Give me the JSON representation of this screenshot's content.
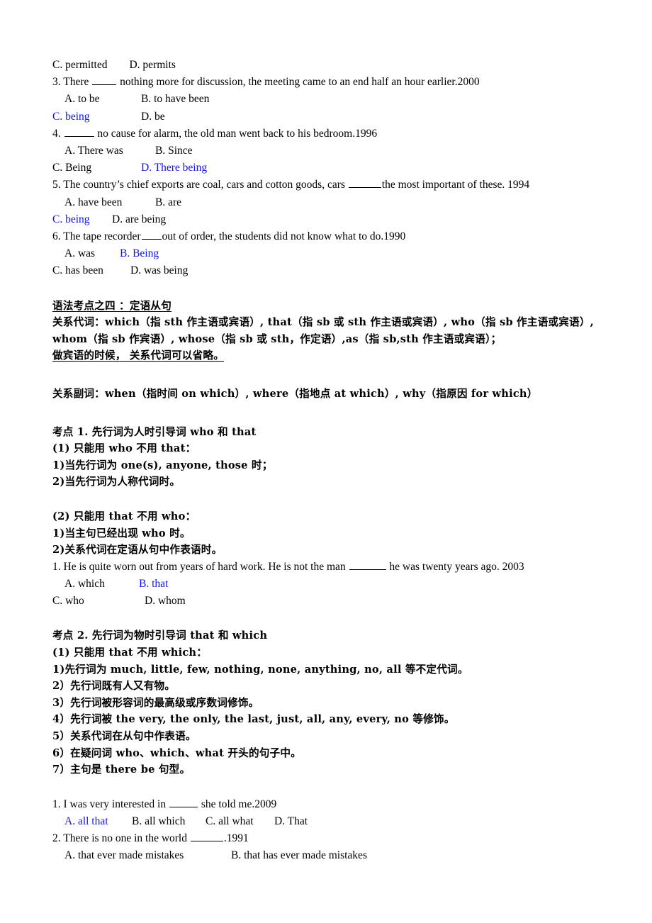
{
  "document": {
    "type": "grammar-study-notes",
    "language": "zh-CN + en",
    "answer_color": "#1414e6",
    "page_background": "#ffffff"
  },
  "block_prev_question": {
    "options_line": "C. permitted        D. permits"
  },
  "questions_being": [
    {
      "stem_pre": "3. There ",
      "stem_post": " nothing more for discussion, the meeting came to an end half an hour earlier.2000",
      "year": "2000",
      "row1": {
        "a": "A. to be",
        "b": "B. to have been",
        "a_correct": false,
        "b_correct": false
      },
      "row2": {
        "c": "C. being",
        "d": "D. be",
        "c_correct": true,
        "d_correct": false
      }
    },
    {
      "stem_pre": "4. ",
      "stem_post": " no cause for alarm, the old man went back to his bedroom.1996",
      "year": "1996",
      "row1": {
        "a": "A. There was",
        "b": "B. Since",
        "a_correct": false,
        "b_correct": false
      },
      "row2": {
        "c": "C. Being",
        "d": "D. There being",
        "c_correct": false,
        "d_correct": true
      }
    },
    {
      "stem_pre": "5. The country’s chief exports are coal, cars and cotton goods, cars ",
      "stem_post": "the most important of these. 1994",
      "year": "1994",
      "row1": {
        "a": "A. have been",
        "b": "B. are",
        "a_correct": false,
        "b_correct": false
      },
      "row2": {
        "c": "C. being",
        "d": "D. are being",
        "c_correct": true,
        "d_correct": false
      }
    },
    {
      "stem_pre": "6. The tape recorder",
      "stem_post": "out of order, the students did not know what to do.1990",
      "year": "1990",
      "row1": {
        "a": "A. was",
        "b": "B. Being",
        "a_correct": false,
        "b_correct": true
      },
      "row2": {
        "c": "C. has been",
        "d": "D. was being",
        "c_correct": false,
        "d_correct": false
      }
    }
  ],
  "section_four": {
    "title": "语法考点之四 ：定语从句",
    "relative_pronouns_line1": "关系代词：which（指 sth 作主语或宾语）, that（指 sb 或 sth 作主语或宾语）, who（指 sb 作主语或宾语）,",
    "relative_pronouns_line2": "whom（指 sb 作宾语）, whose（指 sb 或 sth，作定语）,as（指 sb,sth 作主语或宾语）；",
    "omission_note": "做宾语的时候， 关系代词可以省略。",
    "relative_adverbs": "关系副词：when（指时间 on which）, where（指地点 at which）, why（指原因 for which）"
  },
  "point_1": {
    "heading": "考点 1. 先行词为人时引导词 who 和 that",
    "sub_a": {
      "label": "(1) 只能用 who 不用 that：",
      "items": [
        "1)当先行词为 one(s), anyone, those 时；",
        "2)当先行词为人称代词时。"
      ]
    },
    "sub_b": {
      "label": "(2) 只能用 that 不用 who：",
      "items": [
        "1)当主句已经出现 who 时。",
        "2)关系代词在定语从句中作表语时。"
      ]
    },
    "question": {
      "stem_pre": "1. He is quite worn out from years of hard work. He is not the man ",
      "stem_post": " he was twenty years ago. 2003",
      "year": "2003",
      "row1": {
        "a": "A. which",
        "b": "B. that",
        "a_correct": false,
        "b_correct": true
      },
      "row2": {
        "c": "C. who",
        "d": "D. whom",
        "c_correct": false,
        "d_correct": false
      }
    }
  },
  "point_2": {
    "heading": "考点 2. 先行词为物时引导词 that 和 which",
    "sub_a_label": "(1) 只能用 that 不用 which：",
    "items": [
      "1)先行词为 much, little, few, nothing, none, anything, no, all 等不定代词。",
      "2）先行词既有人又有物。",
      "3）先行词被形容词的最高级或序数词修饰。",
      "4）先行词被 the very, the only, the last, just, all, any, every, no 等修饰。",
      "5）关系代词在从句中作表语。",
      "6）在疑问词 who、which、what 开头的句子中。",
      "7）主句是 there be 句型。"
    ],
    "questions": [
      {
        "stem_pre": "1. I was very interested in ",
        "stem_post": " she told me.2009",
        "year": "2009",
        "options_row": {
          "a": "A. all that",
          "b": "B. all which",
          "c": "C. all what",
          "d": "D. That",
          "a_correct": true,
          "b_correct": false,
          "c_correct": false,
          "d_correct": false
        }
      },
      {
        "stem_pre": "2. There is no one in the world ",
        "stem_post": ".1991",
        "year": "1991",
        "row1": {
          "a": "A. that ever made mistakes",
          "b": "B. that has ever made mistakes",
          "a_correct": false,
          "b_correct": false
        }
      }
    ]
  }
}
